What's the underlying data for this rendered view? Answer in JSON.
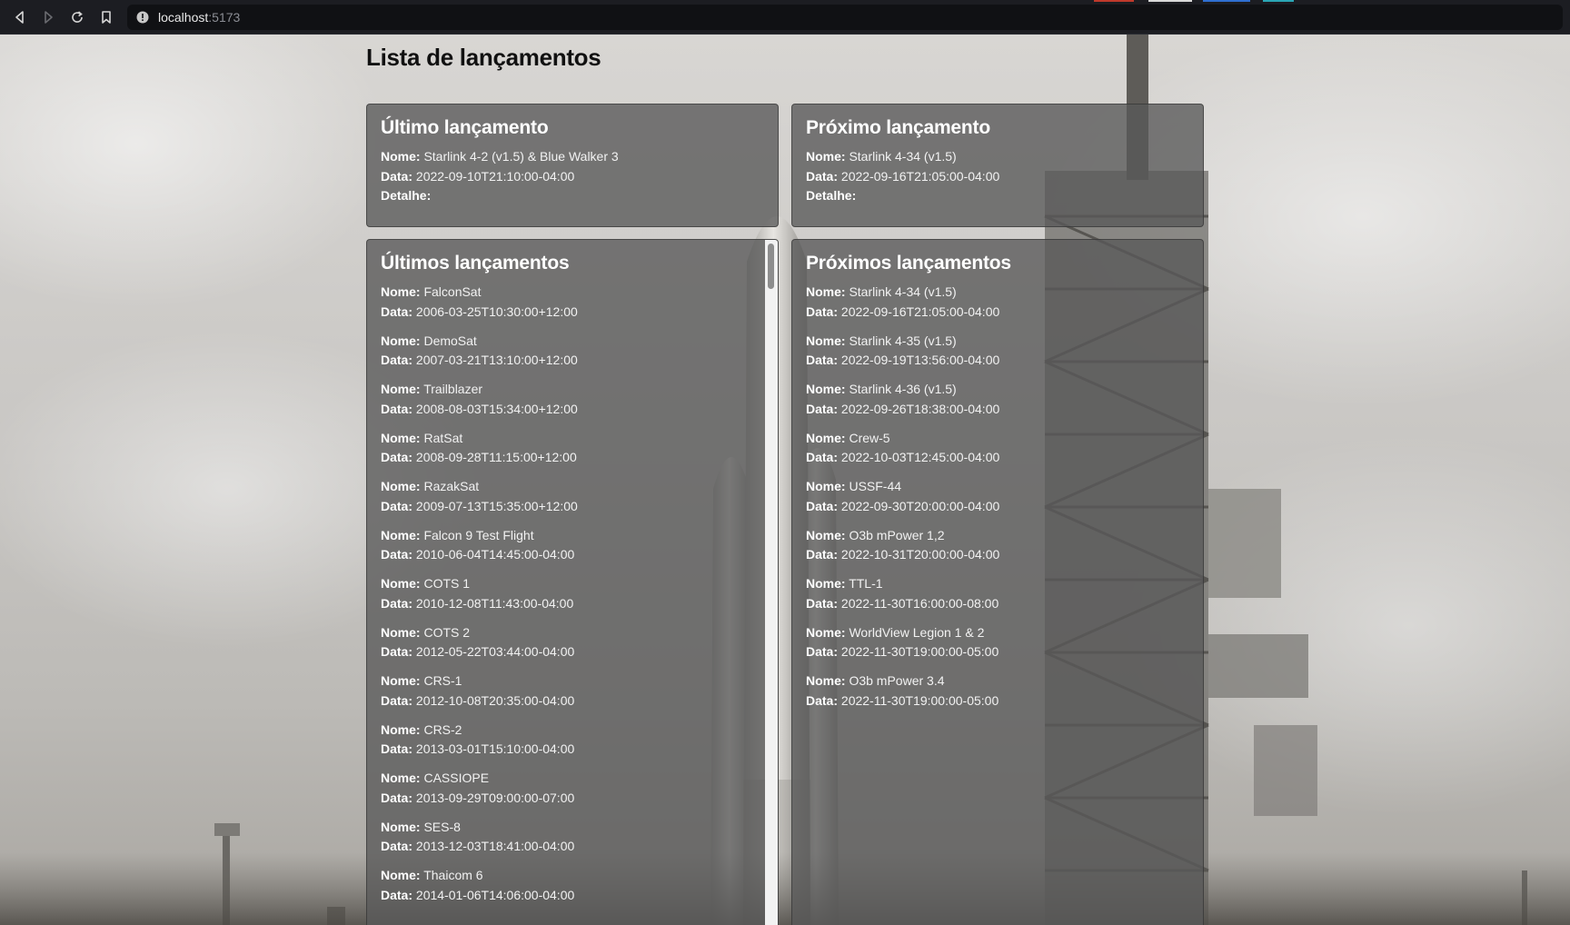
{
  "browser": {
    "url_host": "localhost",
    "url_port": ":5173",
    "icons": [
      "back-icon",
      "forward-icon",
      "reload-icon",
      "bookmark-icon",
      "site-info-icon"
    ]
  },
  "page": {
    "title": "Lista de lançamentos"
  },
  "labels": {
    "nome": "Nome:",
    "data": "Data:",
    "detalhe": "Detalhe:"
  },
  "latest": {
    "heading": "Último lançamento",
    "nome": "Starlink 4-2 (v1.5) & Blue Walker 3",
    "data": "2022-09-10T21:10:00-04:00",
    "detalhe": ""
  },
  "next": {
    "heading": "Próximo lançamento",
    "nome": "Starlink 4-34 (v1.5)",
    "data": "2022-09-16T21:05:00-04:00",
    "detalhe": ""
  },
  "past_launches": {
    "heading": "Últimos lançamentos",
    "items": [
      {
        "nome": "FalconSat",
        "data": "2006-03-25T10:30:00+12:00"
      },
      {
        "nome": "DemoSat",
        "data": "2007-03-21T13:10:00+12:00"
      },
      {
        "nome": "Trailblazer",
        "data": "2008-08-03T15:34:00+12:00"
      },
      {
        "nome": "RatSat",
        "data": "2008-09-28T11:15:00+12:00"
      },
      {
        "nome": "RazakSat",
        "data": "2009-07-13T15:35:00+12:00"
      },
      {
        "nome": "Falcon 9 Test Flight",
        "data": "2010-06-04T14:45:00-04:00"
      },
      {
        "nome": "COTS 1",
        "data": "2010-12-08T11:43:00-04:00"
      },
      {
        "nome": "COTS 2",
        "data": "2012-05-22T03:44:00-04:00"
      },
      {
        "nome": "CRS-1",
        "data": "2012-10-08T20:35:00-04:00"
      },
      {
        "nome": "CRS-2",
        "data": "2013-03-01T15:10:00-04:00"
      },
      {
        "nome": "CASSIOPE",
        "data": "2013-09-29T09:00:00-07:00"
      },
      {
        "nome": "SES-8",
        "data": "2013-12-03T18:41:00-04:00"
      },
      {
        "nome": "Thaicom 6",
        "data": "2014-01-06T14:06:00-04:00"
      }
    ]
  },
  "upcoming_launches": {
    "heading": "Próximos lançamentos",
    "items": [
      {
        "nome": "Starlink 4-34 (v1.5)",
        "data": "2022-09-16T21:05:00-04:00"
      },
      {
        "nome": "Starlink 4-35 (v1.5)",
        "data": "2022-09-19T13:56:00-04:00"
      },
      {
        "nome": "Starlink 4-36 (v1.5)",
        "data": "2022-09-26T18:38:00-04:00"
      },
      {
        "nome": "Crew-5",
        "data": "2022-10-03T12:45:00-04:00"
      },
      {
        "nome": "USSF-44",
        "data": "2022-09-30T20:00:00-04:00"
      },
      {
        "nome": "O3b mPower 1,2",
        "data": "2022-10-31T20:00:00-04:00"
      },
      {
        "nome": "TTL-1",
        "data": "2022-11-30T16:00:00-08:00"
      },
      {
        "nome": "WorldView Legion 1 & 2",
        "data": "2022-11-30T19:00:00-05:00"
      },
      {
        "nome": "O3b mPower 3.4",
        "data": "2022-11-30T19:00:00-05:00"
      }
    ]
  },
  "colors": {
    "panel_bg": "#585858",
    "page_title": "#111111",
    "chrome_bg": "#1c1d22"
  }
}
